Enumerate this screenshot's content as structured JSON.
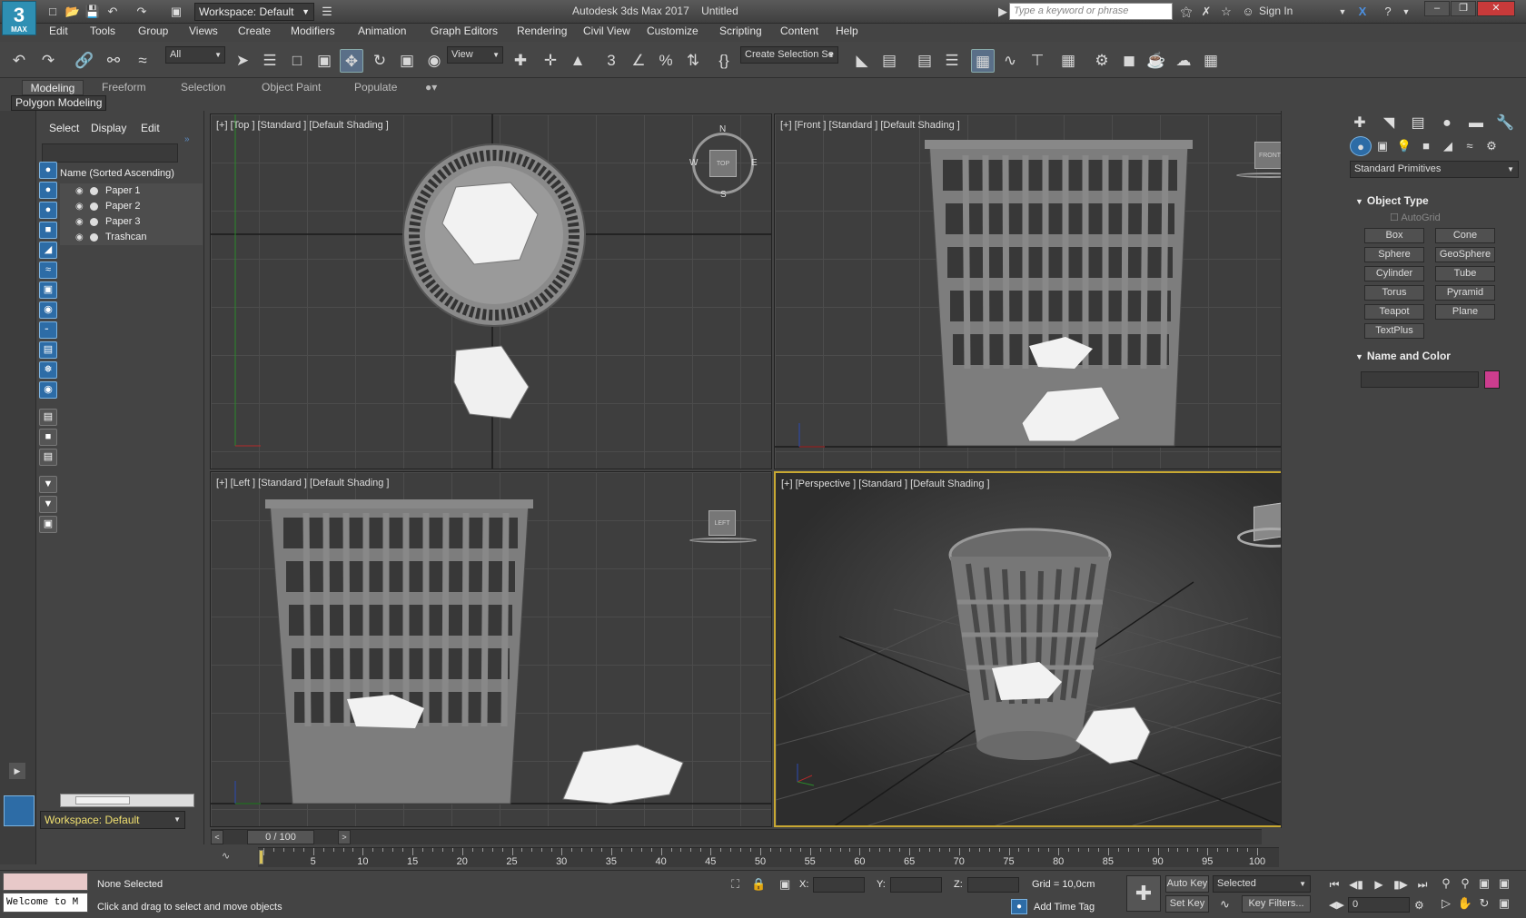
{
  "app": {
    "title": "Autodesk 3ds Max 2017",
    "document": "Untitled",
    "workspace_label": "Workspace: Default",
    "search_placeholder": "Type a keyword or phrase",
    "sign_in": "Sign In",
    "logo_number": "3",
    "logo_text": "MAX"
  },
  "menus": [
    "Edit",
    "Tools",
    "Group",
    "Views",
    "Create",
    "Modifiers",
    "Animation",
    "Graph Editors",
    "Rendering",
    "Civil View",
    "Customize",
    "Scripting",
    "Content",
    "Help"
  ],
  "toolbar": {
    "selection_filter": "All",
    "ref_coord": "View",
    "named_selection": "Create Selection Se"
  },
  "ribbon": {
    "tabs": [
      "Modeling",
      "Freeform",
      "Selection",
      "Object Paint",
      "Populate"
    ],
    "active_tab": "Modeling",
    "panel": "Polygon Modeling"
  },
  "scene_explorer": {
    "tabs": [
      "Select",
      "Display",
      "Edit"
    ],
    "column_header": "Name (Sorted Ascending)",
    "items": [
      "Paper 1",
      "Paper 2",
      "Paper 3",
      "Trashcan"
    ],
    "workspace": "Workspace: Default"
  },
  "viewports": {
    "top": {
      "label": "[+] [Top ] [Standard ] [Default Shading ]",
      "cube": "TOP",
      "compass": [
        "N",
        "S",
        "W",
        "E"
      ]
    },
    "front": {
      "label": "[+] [Front ] [Standard ] [Default Shading ]",
      "cube": "FRONT"
    },
    "left": {
      "label": "[+] [Left ] [Standard ] [Default Shading ]",
      "cube": "LEFT"
    },
    "perspective": {
      "label": "[+] [Perspective ] [Standard ] [Default Shading ]"
    }
  },
  "command_panel": {
    "category": "Standard Primitives",
    "object_type_title": "Object Type",
    "autogrid": "AutoGrid",
    "primitives": [
      "Box",
      "Cone",
      "Sphere",
      "GeoSphere",
      "Cylinder",
      "Tube",
      "Torus",
      "Pyramid",
      "Teapot",
      "Plane",
      "TextPlus"
    ],
    "name_color_title": "Name and Color",
    "color": "#cc3d8e"
  },
  "timeline": {
    "frame": "0 / 100",
    "ticks": [
      5,
      10,
      15,
      20,
      25,
      30,
      35,
      40,
      45,
      50,
      55,
      60,
      65,
      70,
      75,
      80,
      85,
      90,
      95,
      100
    ]
  },
  "status": {
    "selection": "None Selected",
    "prompt": "Click and drag to select and move objects",
    "listener": "Welcome to M",
    "x_label": "X:",
    "y_label": "Y:",
    "z_label": "Z:",
    "grid": "Grid = 10,0cm",
    "add_time_tag": "Add Time Tag",
    "auto_key": "Auto Key",
    "set_key": "Set Key",
    "key_mode": "Selected",
    "key_filters": "Key Filters...",
    "current_frame": "0"
  }
}
